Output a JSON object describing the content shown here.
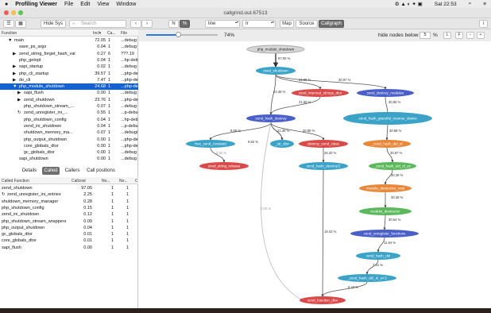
{
  "menubar": {
    "app": "Profiling Viewer",
    "items": [
      "File",
      "Edit",
      "View",
      "Window"
    ],
    "time": "Sat 22:53"
  },
  "window": {
    "title": "callgrind.out.67513"
  },
  "toolbar": {
    "hide_sys": "Hide Sys",
    "search_placeholder": "Search",
    "n": "N",
    "pct": "%",
    "line_select": "line",
    "ir_select": "Ir",
    "map": "Map",
    "source": "Source",
    "callgraph": "Callgraph",
    "info": "i"
  },
  "subbar": {
    "percent": "74%",
    "hide_nodes_label": "hide nodes below",
    "hide_nodes_value": "5",
    "pct_sign": "%",
    "l": "L",
    "f": "F",
    "minus": "−",
    "plus": "+"
  },
  "functions_table": {
    "headers": [
      "Function",
      "Incl▾",
      "Ca...",
      "File"
    ],
    "rows": [
      {
        "name": "main",
        "indent": 1,
        "arrow": "▼",
        "incl": "72.05",
        "calls": "1",
        "file": "...debug"
      },
      {
        "name": "save_ps_args",
        "indent": 2,
        "arrow": "",
        "incl": "0.04",
        "calls": "1",
        "file": "...debug"
      },
      {
        "name": "zend_string_forget_hash_val",
        "indent": 2,
        "arrow": "▶",
        "incl": "0.27",
        "calls": "6",
        "file": "???.19"
      },
      {
        "name": "php_getopt",
        "indent": 2,
        "arrow": "",
        "incl": "0.04",
        "calls": "1",
        "file": "...hp-debu"
      },
      {
        "name": "sapi_startup",
        "indent": 2,
        "arrow": "▶",
        "incl": "0.02",
        "calls": "1",
        "file": "...debug"
      },
      {
        "name": "php_cli_startup",
        "indent": 2,
        "arrow": "▶",
        "incl": "39.57",
        "calls": "1",
        "file": "...php-debu"
      },
      {
        "name": "do_cli",
        "indent": 2,
        "arrow": "▶",
        "incl": "7.47",
        "calls": "1",
        "file": "...php-debu"
      },
      {
        "name": "php_module_shutdown",
        "indent": 2,
        "arrow": "▼",
        "incl": "24.68",
        "calls": "1",
        "file": "...php-debu",
        "selected": true
      },
      {
        "name": "sapi_flush",
        "indent": 3,
        "arrow": "▶",
        "incl": "0.00",
        "calls": "1",
        "file": "...debug"
      },
      {
        "name": "zend_shutdown",
        "indent": 3,
        "arrow": "▶",
        "incl": "23.76",
        "calls": "1",
        "file": "...php-debu"
      },
      {
        "name": "php_shutdown_stream_...",
        "indent": 3,
        "arrow": "",
        "incl": "0.07",
        "calls": "1",
        "file": "...debug"
      },
      {
        "name": "zend_unregister_ini_...",
        "indent": 3,
        "arrow": "↻",
        "incl": "0.55",
        "calls": "1",
        "file": "...p-debug"
      },
      {
        "name": "php_shutdown_config",
        "indent": 3,
        "arrow": "",
        "incl": "0.04",
        "calls": "1",
        "file": "...hp-debu"
      },
      {
        "name": "zend_ini_shutdown",
        "indent": 3,
        "arrow": "",
        "incl": "0.04",
        "calls": "1",
        "file": "...p-debug"
      },
      {
        "name": "shutdown_memory_ma...",
        "indent": 3,
        "arrow": "",
        "incl": "0.07",
        "calls": "1",
        "file": "...debug/"
      },
      {
        "name": "php_output_shutdown",
        "indent": 3,
        "arrow": "",
        "incl": "0.00",
        "calls": "1",
        "file": "...php-debu"
      },
      {
        "name": "core_globals_dtor",
        "indent": 3,
        "arrow": "",
        "incl": "0.00",
        "calls": "1",
        "file": "...php-debu"
      },
      {
        "name": "gc_globals_dtor",
        "indent": 3,
        "arrow": "",
        "incl": "0.00",
        "calls": "1",
        "file": "...debug"
      },
      {
        "name": "sapi_shutdown",
        "indent": 2,
        "arrow": "",
        "incl": "0.00",
        "calls": "1",
        "file": "...debug"
      }
    ]
  },
  "lower_tabs": [
    "Details",
    "Called",
    "Callers",
    "Call positions"
  ],
  "called_table": {
    "headers": [
      "Called Function",
      "Callcost",
      "No...",
      "No...",
      "C"
    ],
    "rows": [
      {
        "name": "zend_shutdown",
        "cost": "97.05",
        "a": "1",
        "b": "1"
      },
      {
        "name": "zend_unregister_ini_entries",
        "cost": "2.25",
        "a": "1",
        "b": "1",
        "icon": true
      },
      {
        "name": "shutdown_memory_manager",
        "cost": "0.28",
        "a": "1",
        "b": "1"
      },
      {
        "name": "php_shutdown_config",
        "cost": "0.15",
        "a": "1",
        "b": "1"
      },
      {
        "name": "zend_ini_shutdown",
        "cost": "0.12",
        "a": "1",
        "b": "1"
      },
      {
        "name": "php_shutdown_stream_wrappers",
        "cost": "0.09",
        "a": "1",
        "b": "1"
      },
      {
        "name": "php_output_shutdown",
        "cost": "0.04",
        "a": "1",
        "b": "1"
      },
      {
        "name": "gc_globals_dtor",
        "cost": "0.01",
        "a": "1",
        "b": "1"
      },
      {
        "name": "core_globals_dtor",
        "cost": "0.01",
        "a": "1",
        "b": "1"
      },
      {
        "name": "sapi_flush",
        "cost": "0.00",
        "a": "1",
        "b": "1"
      }
    ]
  },
  "graph": {
    "nodes": [
      {
        "id": "n0",
        "label": "php_module_shutdown",
        "color": "#d6d6d6",
        "text": "#222"
      },
      {
        "id": "n1",
        "label": "zend_shutdown",
        "color": "#3ba3c8",
        "text": "#fff"
      },
      {
        "id": "n2",
        "label": "zend_interned_strings_dtor",
        "color": "#d94a4a",
        "text": "#fff"
      },
      {
        "id": "n3",
        "label": "zend_destroy_modules",
        "color": "#4a5fc8",
        "text": "#fff"
      },
      {
        "id": "n4",
        "label": "zend_hash_destroy",
        "color": "#4a5fc8",
        "text": "#fff"
      },
      {
        "id": "n5",
        "label": "zend_hash_graceful_reverse_destro",
        "color": "#3ba3c8",
        "text": "#fff"
      },
      {
        "id": "n6",
        "label": "free_zend_constant",
        "color": "#3ba3c8",
        "text": "#fff"
      },
      {
        "id": "n7",
        "label": "_str_dtor",
        "color": "#3ba3c8",
        "text": "#fff"
      },
      {
        "id": "n8",
        "label": "destroy_zend_class",
        "color": "#d94a4a",
        "text": "#fff"
      },
      {
        "id": "n9",
        "label": "_zend_hash_del_el",
        "color": "#e8883a",
        "text": "#fff"
      },
      {
        "id": "n10",
        "label": "zend_string_release",
        "color": "#d94a4a",
        "text": "#fff"
      },
      {
        "id": "n11",
        "label": "zend_hash_destroy'2",
        "color": "#3ba3c8",
        "text": "#fff"
      },
      {
        "id": "n12",
        "label": "_zend_hash_del_el_ex",
        "color": "#5cb85c",
        "text": "#fff"
      },
      {
        "id": "n13",
        "label": "module_destructor_zval",
        "color": "#e8883a",
        "text": "#fff"
      },
      {
        "id": "n14",
        "label": "module_destructor",
        "color": "#5cb85c",
        "text": "#fff"
      },
      {
        "id": "n15",
        "label": "zend_unregister_functions",
        "color": "#4a5fc8",
        "text": "#fff"
      },
      {
        "id": "n16",
        "label": "zend_hash_del",
        "color": "#3ba3c8",
        "text": "#fff"
      },
      {
        "id": "n17",
        "label": "_zend_hash_del_el_ex'2",
        "color": "#3ba3c8",
        "text": "#fff"
      },
      {
        "id": "n18",
        "label": "zend_function_dtor",
        "color": "#d94a4a",
        "text": "#fff"
      }
    ],
    "edges": [
      {
        "from": "n0",
        "to": "n1",
        "label": "97.05 %"
      },
      {
        "from": "n1",
        "to": "n2",
        "label": "21.65 %"
      },
      {
        "from": "n1",
        "to": "n3",
        "label": "30.97 %"
      },
      {
        "from": "n1",
        "to": "n4",
        "label": "44.38 %"
      },
      {
        "from": "n2",
        "to": "n4",
        "label": "21.65 %"
      },
      {
        "from": "n3",
        "to": "n5",
        "label": "30.85 %"
      },
      {
        "from": "n4",
        "to": "n6",
        "label": "9.58 %"
      },
      {
        "from": "n4",
        "to": "n7",
        "label": "9.82 %"
      },
      {
        "from": "n4",
        "to": "n7",
        "label": "21.36 %"
      },
      {
        "from": "n4",
        "to": "n8",
        "label": "26.88 %"
      },
      {
        "from": "n5",
        "to": "n9",
        "label": "30.88 %"
      },
      {
        "from": "n6",
        "to": "n10",
        "label": "3.92 %"
      },
      {
        "from": "n8",
        "to": "n11",
        "label": "26.20 %"
      },
      {
        "from": "n9",
        "to": "n12",
        "label": "30.87 %"
      },
      {
        "from": "n12",
        "to": "n13",
        "label": "30.39 %"
      },
      {
        "from": "n13",
        "to": "n14",
        "label": "30.39 %"
      },
      {
        "from": "n14",
        "to": "n15",
        "label": "30.54 %"
      },
      {
        "from": "n15",
        "to": "n16",
        "label": "11.84 %"
      },
      {
        "from": "n16",
        "to": "n17",
        "label": "7.61 %"
      },
      {
        "from": "n17",
        "to": "n18",
        "label": "6.23 %"
      },
      {
        "from": "n11",
        "to": "n18",
        "label": "19.43 %"
      },
      {
        "from": "n4",
        "to": "n18",
        "label": "0.00 %"
      }
    ]
  }
}
